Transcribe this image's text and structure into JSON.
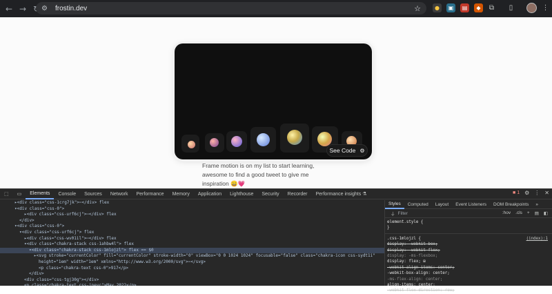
{
  "browser": {
    "url": "frostin.dev",
    "back_icon": "back-arrow-icon",
    "forward_icon": "forward-arrow-icon",
    "reload_icon": "reload-icon"
  },
  "page": {
    "see_code_label": "See Code",
    "quote_text": "Frame motion is on my list to start learning, awesome to find a good tweet to give me inspiration 😄💗"
  },
  "devtools": {
    "tabs": [
      "Elements",
      "Console",
      "Sources",
      "Network",
      "Performance",
      "Memory",
      "Application",
      "Lighthouse",
      "Security",
      "Recorder",
      "Performance insights ⚗"
    ],
    "error_count": "1",
    "styles_tabs": [
      "Styles",
      "Computed",
      "Layout",
      "Event Listeners",
      "DOM Breakpoints",
      "»"
    ],
    "filter_placeholder": "Filter",
    "filter_hov": ":hov",
    "filter_cls": ".cls",
    "code_lines": [
      {
        "indent": 3,
        "html": "▸<div class=\"css-1crg7jk\">⋯</div>  flex"
      },
      {
        "indent": 3,
        "html": "▾<div class=\"css-0\">"
      },
      {
        "indent": 5,
        "html": "▸<div class=\"css-urf6cj\">⋯</div>  flex"
      },
      {
        "indent": 4,
        "html": "</div>"
      },
      {
        "indent": 3,
        "html": "▾<div class=\"css-0\">"
      },
      {
        "indent": 4,
        "html": "▾<div class=\"css-urf6cj\">  flex"
      },
      {
        "indent": 5,
        "html": "▸<div class=\"css-wv01il\">⋯</div>  flex"
      },
      {
        "indent": 5,
        "html": "▾<div class=\"chakra-stack css-1ahbw4l\">  flex"
      },
      {
        "indent": 6,
        "html": "▾<div class=\"chakra-stack css-1mlojzl\">  flex  == $0"
      },
      {
        "indent": 7,
        "html": "▸<svg stroke=\"currentColor\" fill=\"currentColor\" stroke-width=\"0\" viewBox=\"0 0 1024 1024\" focusable=\"false\" class=\"chakra-icon css-sydt1i\""
      },
      {
        "indent": 8,
        "html": "height=\"1em\" width=\"1em\" xmlns=\"http://www.w3.org/2000/svg\">⋯</svg>"
      },
      {
        "indent": 8,
        "html": "<p class=\"chakra-text css-0\">917</p>"
      },
      {
        "indent": 6,
        "html": "</div>"
      },
      {
        "indent": 5,
        "html": "<div class=\"css-tgj30g\"></div>"
      },
      {
        "indent": 5,
        "html": "<p class=\"chakra-text css-jneyc\">May 2022</p>"
      }
    ],
    "styles_rules": [
      {
        "text": "element.style {",
        "cls": ""
      },
      {
        "text": "}",
        "cls": ""
      },
      {
        "text": ".css-1mlojzl {",
        "cls": "",
        "src": "(index):1"
      },
      {
        "text": "  display: -webkit-box;",
        "cls": "prop-struck"
      },
      {
        "text": "  display: -webkit-flex;",
        "cls": "prop-struck"
      },
      {
        "text": "  display: -ms-flexbox;",
        "cls": "prop-dim"
      },
      {
        "text": "  display: flex; ⊞",
        "cls": ""
      },
      {
        "text": "  -webkit-align-items: center;",
        "cls": "prop-struck"
      },
      {
        "text": "  -webkit-box-align: center;",
        "cls": ""
      },
      {
        "text": "  -ms-flex-align: center;",
        "cls": "prop-dim"
      },
      {
        "text": "  align-items: center;",
        "cls": ""
      },
      {
        "text": "  -webkit-flex-direction: row;",
        "cls": "prop-struck"
      }
    ]
  }
}
